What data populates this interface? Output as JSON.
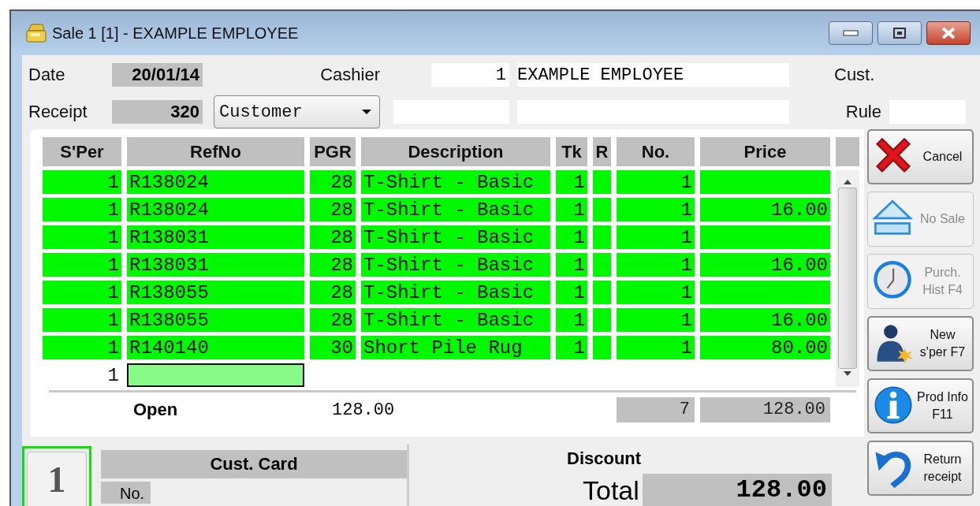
{
  "window": {
    "title": "Sale 1 [1] - EXAMPLE EMPLOYEE"
  },
  "header": {
    "date_label": "Date",
    "date": "20/01/14",
    "receipt_label": "Receipt",
    "receipt": "320",
    "customer_type": "Customer",
    "cashier_label": "Cashier",
    "cashier_no": "1",
    "cashier_name": "EXAMPLE EMPLOYEE",
    "cust_label": "Cust.",
    "rule_label": "Rule"
  },
  "table": {
    "columns": [
      "S'Per",
      "RefNo",
      "PGR",
      "Description",
      "Tk",
      "R",
      "No.",
      "Price"
    ],
    "rows": [
      {
        "kind": "item",
        "s_per": "1",
        "ref_no": "R138024",
        "pgr": "28",
        "description": "T-Shirt - Basic",
        "tk": "1",
        "no": "1"
      },
      {
        "kind": "item",
        "s_per": "1",
        "ref_no": "R138024",
        "pgr": "28",
        "description": "T-Shirt - Basic",
        "tk": "1",
        "no": "1",
        "price": "16.00"
      },
      {
        "kind": "item",
        "s_per": "1",
        "ref_no": "R138031",
        "pgr": "28",
        "description": "T-Shirt - Basic",
        "tk": "1",
        "no": "1"
      },
      {
        "kind": "item",
        "s_per": "1",
        "ref_no": "R138031",
        "pgr": "28",
        "description": "T-Shirt - Basic",
        "tk": "1",
        "no": "1",
        "price": "16.00"
      },
      {
        "kind": "item",
        "s_per": "1",
        "ref_no": "R138055",
        "pgr": "28",
        "description": "T-Shirt - Basic",
        "tk": "1",
        "no": "1"
      },
      {
        "kind": "item",
        "s_per": "1",
        "ref_no": "R138055",
        "pgr": "28",
        "description": "T-Shirt - Basic",
        "tk": "1",
        "no": "1",
        "price": "16.00"
      },
      {
        "kind": "item",
        "s_per": "1",
        "ref_no": "R140140",
        "pgr": "30",
        "description": "Short Pile Rug",
        "tk": "1",
        "no": "1",
        "price": "80.00"
      },
      {
        "kind": "entry",
        "s_per": "1"
      }
    ]
  },
  "totals": {
    "label": "Open",
    "open_amount": "128.00",
    "count": "7",
    "amount": "128.00"
  },
  "sale_tab": {
    "number": "1",
    "selected": true
  },
  "cust_card": {
    "title": "Cust. Card",
    "no_label": "No."
  },
  "discount_label": "Discount",
  "total": {
    "label": "Total",
    "value": "128.00"
  },
  "actions": [
    {
      "kind": "cancel",
      "label": "Cancel",
      "disabled": false
    },
    {
      "kind": "no-sale",
      "label": "No Sale",
      "disabled": true
    },
    {
      "kind": "history",
      "label": "Purch. Hist F4",
      "disabled": true
    },
    {
      "kind": "salesperson",
      "label": "New s'per F7",
      "disabled": false
    },
    {
      "kind": "info",
      "label": "Prod Info F11",
      "disabled": false
    },
    {
      "kind": "return",
      "label": "Return receipt",
      "disabled": false
    }
  ]
}
